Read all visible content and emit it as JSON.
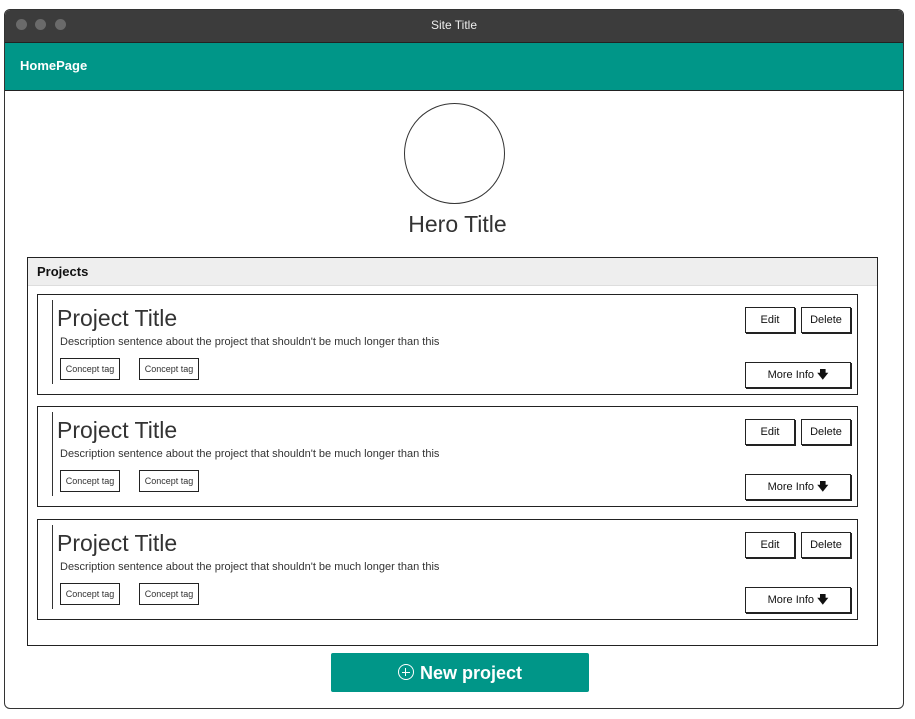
{
  "window": {
    "title": "Site Title"
  },
  "navbar": {
    "brand": "HomePage"
  },
  "hero": {
    "title": "Hero Title"
  },
  "projects_panel": {
    "title": "Projects",
    "cards": [
      {
        "title": "Project Title",
        "description": "Description sentence about the project that shouldn't be much longer than this",
        "tags": [
          "Concept tag",
          "Concept tag"
        ],
        "edit_label": "Edit",
        "delete_label": "Delete",
        "more_label": "More Info"
      },
      {
        "title": "Project Title",
        "description": "Description sentence about the project that shouldn't be much longer than this",
        "tags": [
          "Concept tag",
          "Concept tag"
        ],
        "edit_label": "Edit",
        "delete_label": "Delete",
        "more_label": "More Info"
      },
      {
        "title": "Project Title",
        "description": "Description sentence about the project that shouldn't be much longer than this",
        "tags": [
          "Concept tag",
          "Concept tag"
        ],
        "edit_label": "Edit",
        "delete_label": "Delete",
        "more_label": "More Info"
      }
    ]
  },
  "new_project": {
    "label": "New project",
    "icon": "plus-circle-icon"
  },
  "colors": {
    "accent": "#009688",
    "titlebar": "#3c3c3c"
  }
}
